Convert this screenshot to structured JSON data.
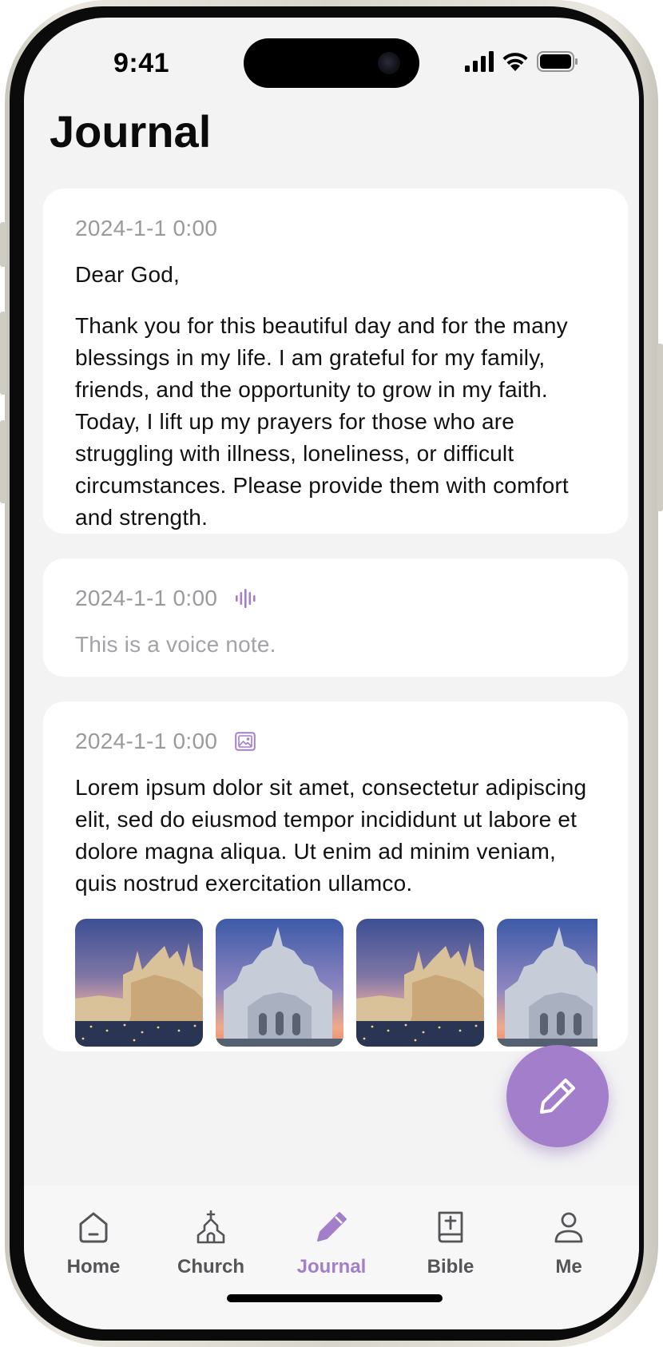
{
  "status_bar": {
    "time": "9:41"
  },
  "page_title": "Journal",
  "entries": [
    {
      "date": "2024-1-1 0:00",
      "type": "text",
      "greeting": "Dear God,",
      "body_1": "Thank you for this beautiful day and for the many blessings in my life. I am grateful for my family, friends, and the opportunity to grow in my faith.",
      "body_2": "Today, I lift up my prayers for those who are struggling with illness, loneliness, or difficult circumstances. Please provide them with comfort and strength."
    },
    {
      "date": "2024-1-1 0:00",
      "type": "voice",
      "icon": "voice-wave-icon",
      "text": "This is a voice note."
    },
    {
      "date": "2024-1-1 0:00",
      "type": "photo",
      "icon": "image-icon",
      "text": "Lorem ipsum dolor sit amet, consectetur adipiscing elit, sed do eiusmod tempor incididunt ut labore et dolore magna aliqua. Ut enim ad minim veniam, quis nostrud exercitation ullamco.",
      "photos": [
        "cathedral-dusk",
        "cathedral-closeup",
        "cathedral-dusk",
        "cathedral-closeup"
      ]
    }
  ],
  "fab": {
    "icon": "pencil-icon"
  },
  "tabs": [
    {
      "label": "Home",
      "icon": "home-icon"
    },
    {
      "label": "Church",
      "icon": "church-icon"
    },
    {
      "label": "Journal",
      "icon": "pencil-icon",
      "active": true
    },
    {
      "label": "Bible",
      "icon": "bible-icon"
    },
    {
      "label": "Me",
      "icon": "person-icon"
    }
  ],
  "colors": {
    "accent": "#a37fcb",
    "date_gray": "#9a9a9e",
    "background": "#f3f3f4",
    "card": "#ffffff"
  }
}
